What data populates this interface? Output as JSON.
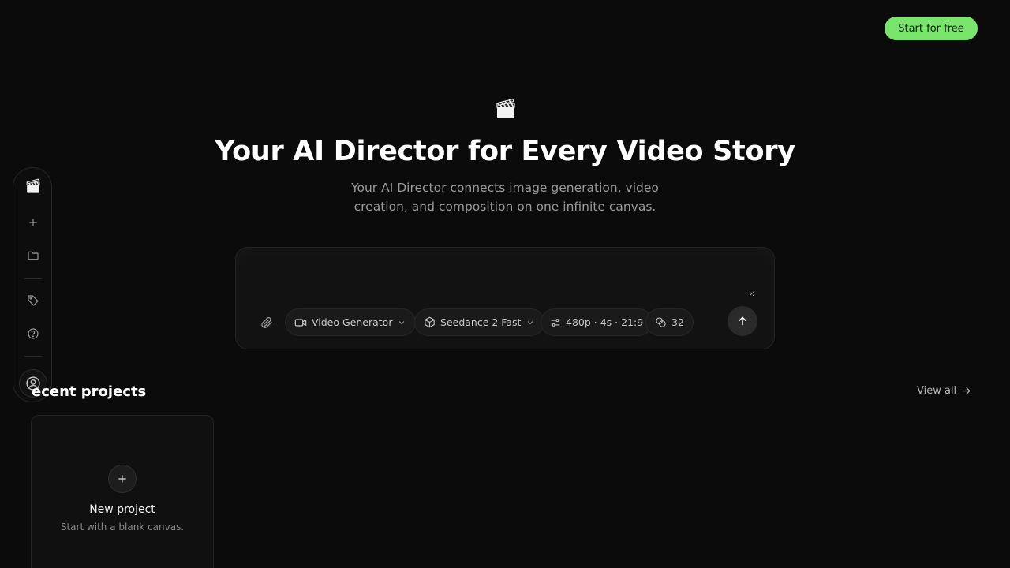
{
  "header": {
    "cta_label": "Start for free"
  },
  "hero": {
    "icon": "clapperboard-icon",
    "title": "Your AI Director for Every Video Story",
    "subtitle": "Your AI Director connects image generation, video creation, and composition on one infinite canvas."
  },
  "prompt": {
    "value": "",
    "attach_icon": "paperclip-icon",
    "chips": [
      {
        "icon": "video-camera-icon",
        "label": "Video Generator",
        "dropdown": true
      },
      {
        "icon": "cube-icon",
        "label": "Seedance 2 Fast",
        "dropdown": true
      },
      {
        "icon": "sliders-icon",
        "label": "480p · 4s · 21:9",
        "dropdown": false
      },
      {
        "icon": "coins-icon",
        "label": "32",
        "dropdown": false
      }
    ],
    "send_icon": "arrow-up-icon"
  },
  "sidebar": {
    "items": [
      {
        "icon": "clapperboard-icon"
      },
      {
        "icon": "plus-icon"
      },
      {
        "icon": "folder-icon"
      },
      {
        "icon": "tag-icon"
      },
      {
        "icon": "help-circle-icon"
      },
      {
        "icon": "user-avatar-icon"
      }
    ]
  },
  "recent": {
    "title": "ecent projects",
    "view_all": "View all",
    "new_project": {
      "title": "New project",
      "subtitle": "Start with a blank canvas."
    }
  },
  "colors": {
    "accent": "#7ae56d",
    "background": "#0b0b0b"
  }
}
